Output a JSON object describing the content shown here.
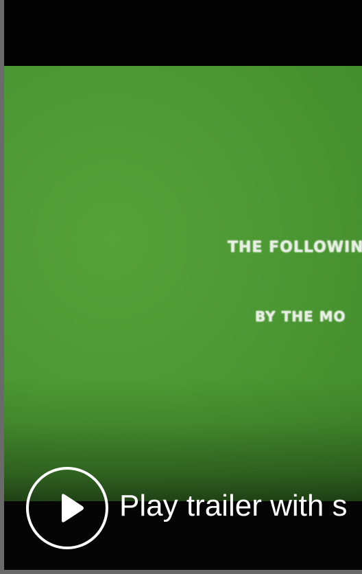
{
  "video": {
    "frame_text_line1": "THE FOLLOWIN",
    "frame_text_line2": "BY THE MO"
  },
  "play_control": {
    "label": "Play trailer with s",
    "icon": "play-icon"
  },
  "colors": {
    "frame_green": "#4a9632",
    "letterbox": "#030303",
    "border_gray": "#6a6a6a",
    "control_white": "#ffffff"
  }
}
